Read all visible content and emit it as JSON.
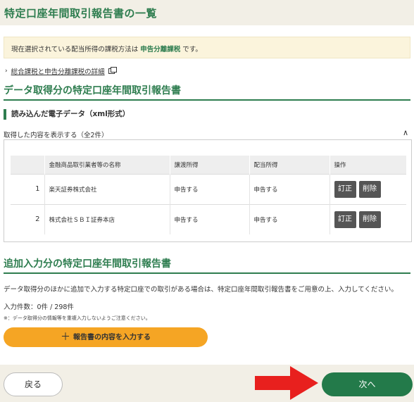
{
  "header": {
    "title": "特定口座年間取引報告書の一覧"
  },
  "notice": {
    "prefix": "現在選択されている配当所得の課税方法は ",
    "method": "申告分離課税",
    "suffix": " です。"
  },
  "detail_link": {
    "label": "総合課税と申告分離課税の詳細"
  },
  "section1": {
    "title": "データ取得分の特定口座年間取引報告書",
    "subheading": "読み込んだ電子データ（xml形式）",
    "count_text": "取得した内容を表示する（全2件）",
    "table": {
      "headers": [
        "",
        "金融商品取引業者等の名称",
        "譲渡所得",
        "配当所得",
        "操作"
      ],
      "rows": [
        {
          "no": "1",
          "name": "楽天証券株式会社",
          "transfer": "申告する",
          "dividend": "申告する"
        },
        {
          "no": "2",
          "name": "株式会社ＳＢＩ証券本店",
          "transfer": "申告する",
          "dividend": "申告する"
        }
      ],
      "correct_label": "訂正",
      "delete_label": "削除"
    }
  },
  "section2": {
    "title": "追加入力分の特定口座年間取引報告書",
    "description": "データ取得分のほかに追加で入力する特定口座での取引がある場合は、特定口座年間取引報告書をご用意の上、入力してください。",
    "input_count": "入力件数：0件 / 298件",
    "note": "※：データ取得分の情報等を重複入力しないようご注意ください。",
    "add_button": "報告書の内容を入力する"
  },
  "footer": {
    "back_label": "戻る",
    "next_label": "次へ"
  },
  "colors": {
    "brand_green": "#2e7d4f",
    "next_green": "#237a4a",
    "add_orange": "#f5a524",
    "arrow_red": "#e8201e"
  }
}
